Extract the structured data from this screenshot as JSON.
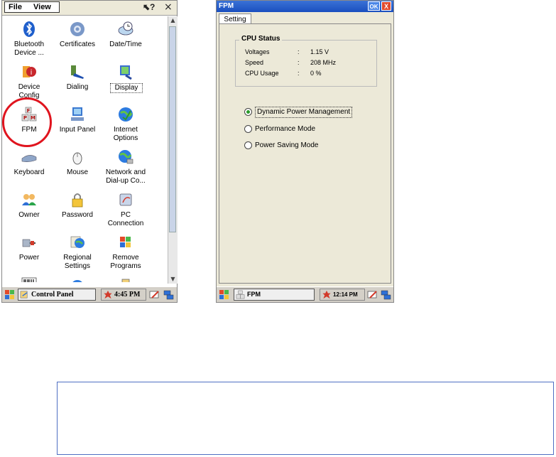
{
  "control_panel": {
    "menu": {
      "file": "File",
      "view": "View",
      "help_icon": "help-pointer-icon",
      "close": "×"
    },
    "items": [
      {
        "label": "Bluetooth\nDevice ...",
        "icon": "bluetooth-icon"
      },
      {
        "label": "Certificates",
        "icon": "certificates-icon"
      },
      {
        "label": "Date/Time",
        "icon": "clock-icon"
      },
      {
        "label": "Device\nConfig",
        "icon": "device-config-icon"
      },
      {
        "label": "Dialing",
        "icon": "phone-icon"
      },
      {
        "label": "Display",
        "icon": "display-icon"
      },
      {
        "label": "FPM",
        "icon": "fpm-icon",
        "highlighted": true
      },
      {
        "label": "Input Panel",
        "icon": "input-panel-icon"
      },
      {
        "label": "Internet\nOptions",
        "icon": "internet-globe-icon"
      },
      {
        "label": "Keyboard",
        "icon": "keyboard-icon"
      },
      {
        "label": "Mouse",
        "icon": "mouse-icon"
      },
      {
        "label": "Network and\nDial-up Co...",
        "icon": "network-globe-icon"
      },
      {
        "label": "Owner",
        "icon": "owner-icon"
      },
      {
        "label": "Password",
        "icon": "password-lock-icon"
      },
      {
        "label": "PC\nConnection",
        "icon": "pc-connection-icon"
      },
      {
        "label": "Power",
        "icon": "power-icon"
      },
      {
        "label": "Regional\nSettings",
        "icon": "regional-globe-icon"
      },
      {
        "label": "Remove\nPrograms",
        "icon": "remove-programs-icon"
      }
    ],
    "taskbar": {
      "task": "Control Panel",
      "clock": "4:45 PM"
    }
  },
  "fpm": {
    "title": "FPM",
    "ok": "OK",
    "close": "X",
    "tab": "Setting",
    "cpu_status": {
      "title": "CPU Status",
      "rows": [
        {
          "key": "Voltages",
          "sep": ":",
          "value": "1.15 V"
        },
        {
          "key": "Speed",
          "sep": ":",
          "value": "208 MHz"
        },
        {
          "key": "CPU Usage",
          "sep": ":",
          "value": "0 %"
        }
      ]
    },
    "modes": [
      {
        "label": "Dynamic Power Management",
        "selected": true
      },
      {
        "label": "Performance Mode",
        "selected": false
      },
      {
        "label": "Power Saving Mode",
        "selected": false
      }
    ],
    "taskbar": {
      "task": "FPM",
      "clock": "12:14 PM"
    }
  },
  "colors": {
    "highlight_ring": "#e0141e",
    "titlebar": "#1a4fbf",
    "note_border": "#4f6fc2"
  }
}
